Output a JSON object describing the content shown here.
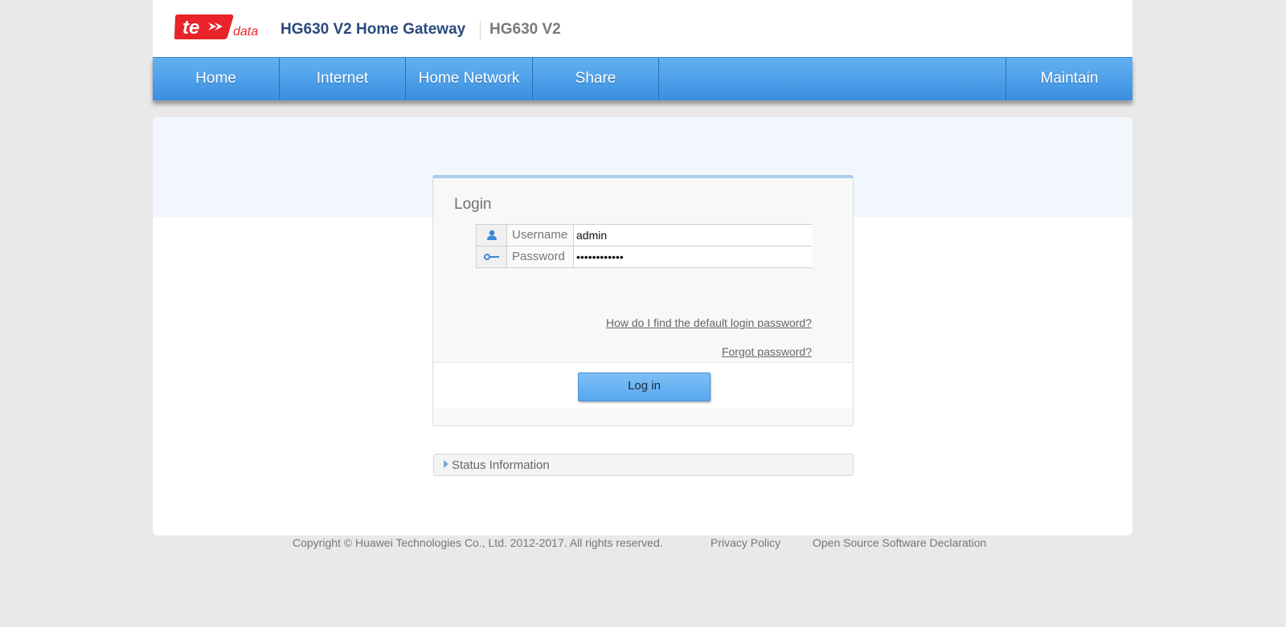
{
  "header": {
    "logo_text": "te data",
    "title": "HG630 V2 Home Gateway",
    "model": "HG630 V2"
  },
  "nav": {
    "items": [
      {
        "label": "Home"
      },
      {
        "label": "Internet"
      },
      {
        "label": "Home Network"
      },
      {
        "label": "Share"
      },
      {
        "label": "Maintain"
      }
    ]
  },
  "login": {
    "title": "Login",
    "username_label": "Username",
    "username_value": "admin",
    "password_label": "Password",
    "password_value": "••••••••••••",
    "default_password_link": "How do I find the default login password?",
    "forgot_password_link": "Forgot password?",
    "button_label": "Log in"
  },
  "status": {
    "label": "Status Information"
  },
  "footer": {
    "copyright": "Copyright © Huawei Technologies Co., Ltd. 2012-2017. All rights reserved.",
    "privacy": "Privacy Policy",
    "oss": "Open Source Software Declaration"
  },
  "colors": {
    "brand_red": "#e8232a",
    "nav_blue": "#4a9ee8",
    "title_blue": "#2a4a7c"
  },
  "icons": {
    "user": "user-icon",
    "key": "key-icon",
    "status_arrow": "triangle-right-icon"
  }
}
